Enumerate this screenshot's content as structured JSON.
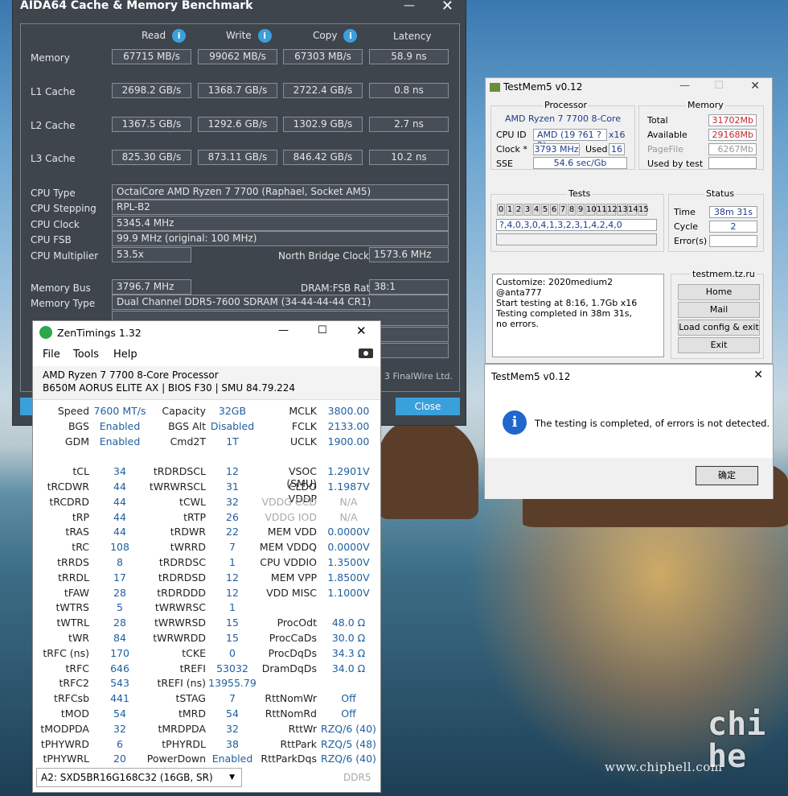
{
  "desktop": {
    "watermark": "www.chiphell.com",
    "logo": "chiphell"
  },
  "aida": {
    "title": "AIDA64 Cache & Memory Benchmark",
    "headers": [
      "Read",
      "Write",
      "Copy",
      "Latency"
    ],
    "rows": [
      {
        "label": "Memory",
        "vals": [
          "67715 MB/s",
          "99062 MB/s",
          "67303 MB/s",
          "58.9 ns"
        ]
      },
      {
        "label": "L1 Cache",
        "vals": [
          "2698.2 GB/s",
          "1368.7 GB/s",
          "2722.4 GB/s",
          "0.8 ns"
        ]
      },
      {
        "label": "L2 Cache",
        "vals": [
          "1367.5 GB/s",
          "1292.6 GB/s",
          "1302.9 GB/s",
          "2.7 ns"
        ]
      },
      {
        "label": "L3 Cache",
        "vals": [
          "825.30 GB/s",
          "873.11 GB/s",
          "846.42 GB/s",
          "10.2 ns"
        ]
      }
    ],
    "cpu_type_label": "CPU Type",
    "cpu_type": "OctalCore AMD Ryzen 7 7700  (Raphael, Socket AM5)",
    "cpu_stepping_label": "CPU Stepping",
    "cpu_stepping": "RPL-B2",
    "cpu_clock_label": "CPU Clock",
    "cpu_clock": "5345.4 MHz",
    "cpu_fsb_label": "CPU FSB",
    "cpu_fsb": "99.9 MHz  (original: 100 MHz)",
    "cpu_mult_label": "CPU Multiplier",
    "cpu_mult": "53.5x",
    "nb_clock_label": "North Bridge Clock",
    "nb_clock": "1573.6 MHz",
    "mem_bus_label": "Memory Bus",
    "mem_bus": "3796.7 MHz",
    "dram_ratio_label": "DRAM:FSB Ratio",
    "dram_ratio": "38:1",
    "mem_type_label": "Memory Type",
    "mem_type": "Dual Channel DDR5-7600 SDRAM  (34-44-44-44 CR1)",
    "copyright": "3 FinalWire Ltd.",
    "close": "Close"
  },
  "testmem": {
    "title": "TestMem5 v0.12",
    "processor_title": "Processor",
    "cpu_name": "AMD Ryzen 7 7700 8-Core",
    "cpuid_label": "CPU ID",
    "cpuid": "AMD  (19 ?61 ?2)",
    "threads": "x16",
    "clock_label": "Clock *",
    "clock": "3793 MHz",
    "used_label": "Used",
    "used": "16",
    "sse_label": "SSE",
    "sse": "54.6 sec/Gb",
    "memory_title": "Memory",
    "total_label": "Total",
    "total": "31702Mb",
    "avail_label": "Available",
    "avail": "29168Mb",
    "page_label": "PageFile",
    "page": "6267Mb",
    "usedby_label": "Used by test",
    "usedby": "",
    "tests_title": "Tests",
    "tests": [
      "0",
      "1",
      "2",
      "3",
      "4",
      "5",
      "6",
      "7",
      "8",
      "9",
      "10",
      "11",
      "12",
      "13",
      "14",
      "15"
    ],
    "sequence": "?,4,0,3,0,4,1,3,2,3,1,4,2,4,0",
    "status_title": "Status",
    "time_label": "Time",
    "time": "38m 31s",
    "cycle_label": "Cycle",
    "cycle": "2",
    "errors_label": "Error(s)",
    "errors": "",
    "log": [
      "Customize: 2020medium2 @anta777",
      "Start testing at 8:16, 1.7Gb x16",
      "Testing completed in 38m 31s,",
      "no errors."
    ],
    "site": "testmem.tz.ru",
    "buttons": [
      "Home",
      "Mail",
      "Load config & exit",
      "Exit"
    ]
  },
  "dialog": {
    "title": "TestMem5 v0.12",
    "message": "The testing is completed, of errors is not detected.",
    "ok": "确定"
  },
  "zen": {
    "title": "ZenTimings 1.32",
    "menu": [
      "File",
      "Tools",
      "Help"
    ],
    "cpu": "AMD Ryzen 7 7700 8-Core Processor",
    "board": "B650M AORUS ELITE AX | BIOS F30 | SMU 84.79.224",
    "rows": [
      [
        "Speed",
        "7600 MT/s",
        "Capacity",
        "32GB",
        "MCLK",
        "3800.00"
      ],
      [
        "BGS",
        "Enabled",
        "BGS Alt",
        "Disabled",
        "FCLK",
        "2133.00"
      ],
      [
        "GDM",
        "Enabled",
        "Cmd2T",
        "1T",
        "UCLK",
        "1900.00"
      ],
      [
        "",
        "",
        "",
        "",
        "",
        ""
      ],
      [
        "tCL",
        "34",
        "tRDRDSCL",
        "12",
        "VSOC (SMU)",
        "1.2901V"
      ],
      [
        "tRCDWR",
        "44",
        "tWRWRSCL",
        "31",
        "CLDO VDDP",
        "1.1987V"
      ],
      [
        "tRCDRD",
        "44",
        "tCWL",
        "32",
        "VDDG CCD",
        "N/A"
      ],
      [
        "tRP",
        "44",
        "tRTP",
        "26",
        "VDDG IOD",
        "N/A"
      ],
      [
        "tRAS",
        "44",
        "tRDWR",
        "22",
        "MEM VDD",
        "0.0000V"
      ],
      [
        "tRC",
        "108",
        "tWRRD",
        "7",
        "MEM VDDQ",
        "0.0000V"
      ],
      [
        "tRRDS",
        "8",
        "tRDRDSC",
        "1",
        "CPU VDDIO",
        "1.3500V"
      ],
      [
        "tRRDL",
        "17",
        "tRDRDSD",
        "12",
        "MEM VPP",
        "1.8500V"
      ],
      [
        "tFAW",
        "28",
        "tRDRDDD",
        "12",
        "VDD MISC",
        "1.1000V"
      ],
      [
        "tWTRS",
        "5",
        "tWRWRSC",
        "1",
        "",
        ""
      ],
      [
        "tWTRL",
        "28",
        "tWRWRSD",
        "15",
        "ProcOdt",
        "48.0 Ω"
      ],
      [
        "tWR",
        "84",
        "tWRWRDD",
        "15",
        "ProcCaDs",
        "30.0 Ω"
      ],
      [
        "tRFC (ns)",
        "170",
        "tCKE",
        "0",
        "ProcDqDs",
        "34.3 Ω"
      ],
      [
        "tRFC",
        "646",
        "tREFI",
        "53032",
        "DramDqDs",
        "34.0 Ω"
      ],
      [
        "tRFC2",
        "543",
        "tREFI (ns)",
        "13955.79",
        "",
        ""
      ],
      [
        "tRFCsb",
        "441",
        "tSTAG",
        "7",
        "RttNomWr",
        "Off"
      ],
      [
        "tMOD",
        "54",
        "tMRD",
        "54",
        "RttNomRd",
        "Off"
      ],
      [
        "tMODPDA",
        "32",
        "tMRDPDA",
        "32",
        "RttWr",
        "RZQ/6 (40)"
      ],
      [
        "tPHYWRD",
        "6",
        "tPHYRDL",
        "38",
        "RttPark",
        "RZQ/5 (48)"
      ],
      [
        "tPHYWRL",
        "20",
        "PowerDown",
        "Enabled",
        "RttParkDqs",
        "RZQ/6 (40)"
      ]
    ],
    "module": "A2: SXD5BR16G168C32 (16GB, SR)",
    "ddr": "DDR5"
  }
}
